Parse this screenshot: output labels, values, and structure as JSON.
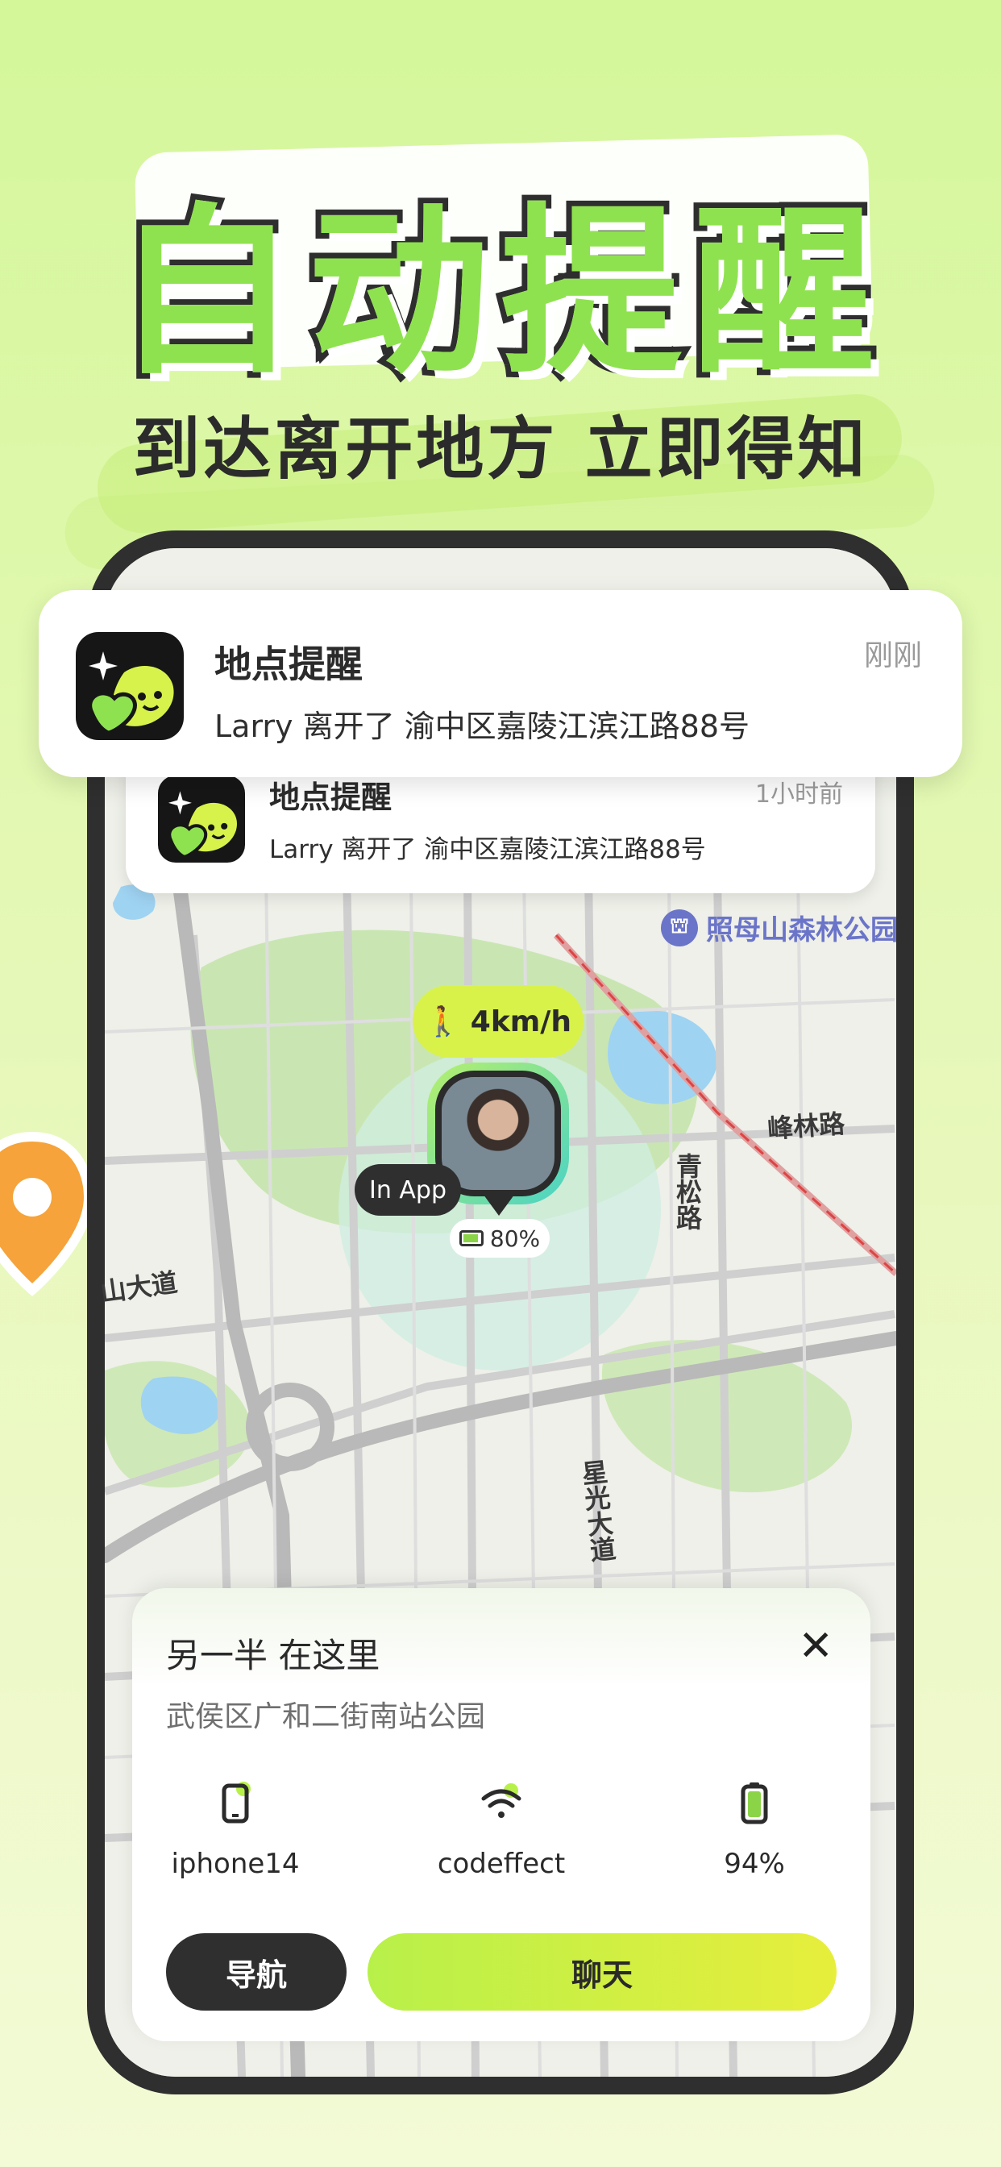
{
  "headline": "自动提醒",
  "subtitle": "到达离开地方 立即得知",
  "notifications": [
    {
      "title": "地点提醒",
      "body": "Larry 离开了 渝中区嘉陵江滨江路88号",
      "time": "刚刚"
    },
    {
      "title": "地点提醒",
      "body": "Larry 离开了 渝中区嘉陵江滨江路88号",
      "time": "1小时前"
    }
  ],
  "map": {
    "poi": "照母山森林公园",
    "poi_icon": "park-icon",
    "labels": {
      "road_1": "峰林路",
      "road_2": "青松路",
      "road_3": "山大道",
      "road_4": "星光大道"
    }
  },
  "partner": {
    "speed": "4km/h",
    "status": "In App",
    "battery": "80%"
  },
  "sheet": {
    "title": "另一半 在这里",
    "address": "武侯区广和二街南站公园",
    "device": "iphone14",
    "wifi": "codeffect",
    "battery": "94%",
    "nav_button": "导航",
    "chat_button": "聊天"
  },
  "colors": {
    "accent_green": "#8fe24f",
    "lime": "#d9f24a",
    "dark": "#2f2f2f"
  }
}
